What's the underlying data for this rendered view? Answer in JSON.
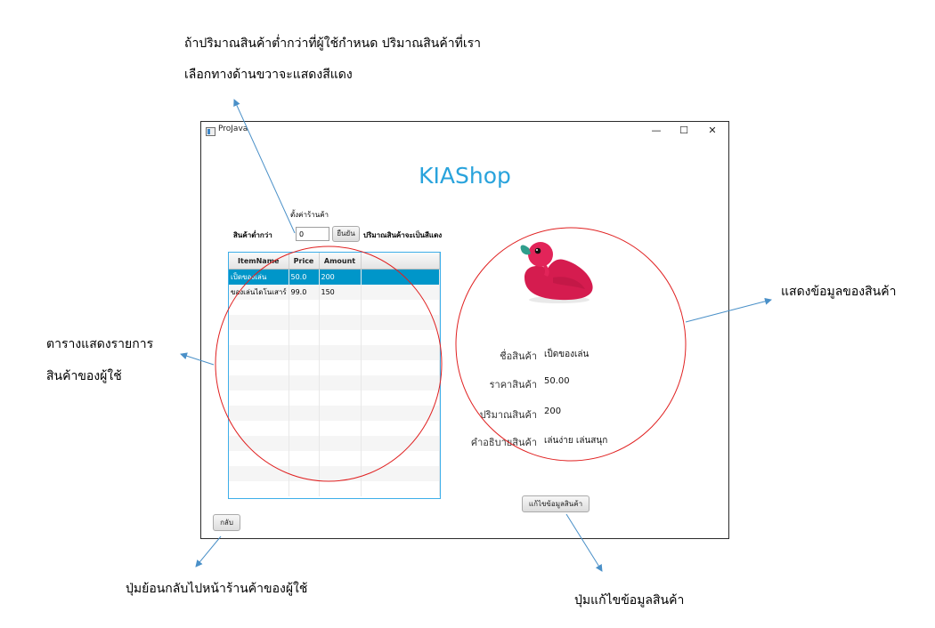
{
  "annotations": {
    "top_note_line1": "ถ้าปริมาณสินค้าต่ำกว่าที่ผู้ใช้กำหนด ปริมาณสินค้าที่เรา",
    "top_note_line2": "เลือกทางด้านขวาจะแสดงสีแดง",
    "left_note_line1": "ตารางแสดงรายการ",
    "left_note_line2": "สินค้าของผู้ใช้",
    "right_note": "แสดงข้อมูลของสินค้า",
    "bottom_left_note": "ปุ่มย้อนกลับไปหน้าร้านค้าของผู้ใช้",
    "bottom_right_note": "ปุ่มแก้ไขข้อมูลสินค้า"
  },
  "window": {
    "title": "ProJava",
    "controls": {
      "minimize": "—",
      "maximize": "☐",
      "close": "✕"
    }
  },
  "app": {
    "shop_title": "KIAShop",
    "settings_label": "ตั้งค่าร้านค้า",
    "threshold_label": "สินค้าต่ำกว่า",
    "threshold_value": "0",
    "confirm_button": "ยืนยัน",
    "threshold_hint": "ปริมาณสินค้าจะเป็นสีแดง",
    "table": {
      "headers": [
        "ItemName",
        "Price",
        "Amount"
      ],
      "rows": [
        [
          "เป็ดของเล่น",
          "50.0",
          "200"
        ],
        [
          "ของเล่นไดโนเสาร์",
          "99.0",
          "150"
        ]
      ]
    },
    "detail": {
      "name_label": "ชื่อสินค้า",
      "name_value": "เป็ดของเล่น",
      "price_label": "ราคาสินค้า",
      "price_value": "50.00",
      "amount_label": "ปริมาณสินค้า",
      "amount_value": "200",
      "desc_label": "คำอธิบายสินค้า",
      "desc_value": "เล่นง่าย เล่นสนุก"
    },
    "edit_button": "แก้ไขข้อมูลสินค้า",
    "back_button": "กลับ"
  },
  "colors": {
    "accent": "#29a3dc",
    "selection": "#0096c9",
    "table_border": "#3daee9",
    "annotation_circle": "#e02020",
    "annotation_arrow": "#4a90c8"
  }
}
